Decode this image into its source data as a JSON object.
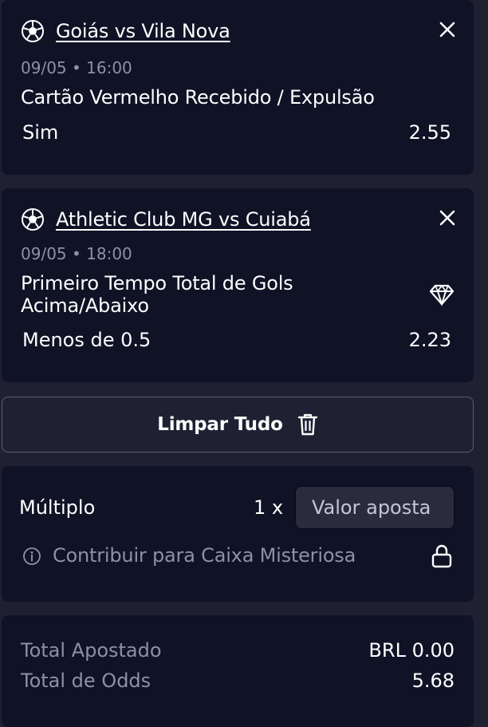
{
  "bets": [
    {
      "match": "Goiás vs Vila Nova",
      "datetime": "09/05 • 16:00",
      "market": "Cartão Vermelho Recebido / Expulsão",
      "selection": "Sim",
      "odds": "2.55",
      "sport_icon": "soccer-ball-icon",
      "remove_icon": "close-icon"
    },
    {
      "match": "Athletic Club MG vs Cuiabá",
      "datetime": "09/05 • 18:00",
      "market_line1": "Primeiro Tempo Total de Gols",
      "market_line2": "Acima/Abaixo",
      "selection": "Menos de 0.5",
      "odds": "2.23",
      "sport_icon": "soccer-ball-icon",
      "remove_icon": "close-icon",
      "badge_icon": "diamond-icon"
    }
  ],
  "clear_all": {
    "label": "Limpar Tudo",
    "icon": "trash-icon"
  },
  "multiple": {
    "label": "Múltiplo",
    "count": "1 x",
    "stake_placeholder": "Valor aposta",
    "mystery_box_label": "Contribuir para Caixa Misteriosa",
    "info_icon": "info-icon",
    "lock_icon": "lock-icon"
  },
  "totals": {
    "staked_label": "Total Apostado",
    "staked_value": "BRL 0.00",
    "odds_label": "Total de Odds",
    "odds_value": "5.68"
  },
  "colors": {
    "background": "#1f2032",
    "card": "#101226",
    "muted_text": "#8e90a4",
    "input_bg": "#2a2c3e"
  }
}
